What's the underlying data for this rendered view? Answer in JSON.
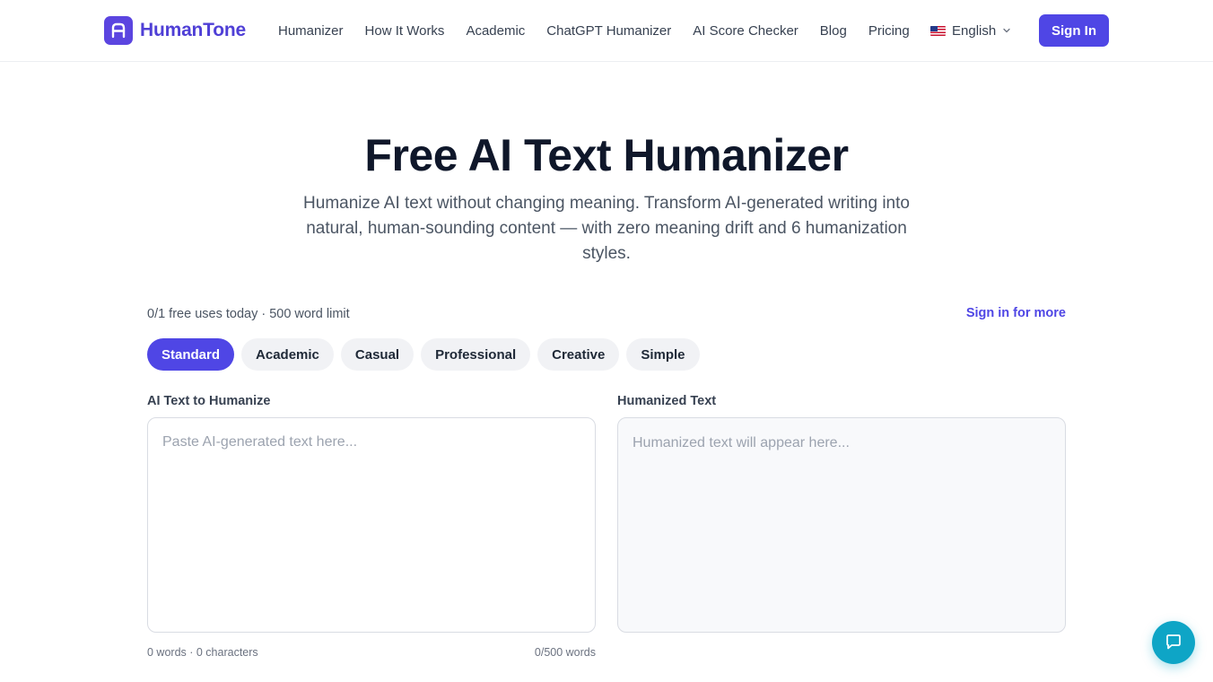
{
  "brand": {
    "name": "HumanTone",
    "color": "#4f46e5"
  },
  "nav": {
    "items": [
      {
        "label": "Humanizer"
      },
      {
        "label": "How It Works"
      },
      {
        "label": "Academic"
      },
      {
        "label": "ChatGPT Humanizer"
      },
      {
        "label": "AI Score Checker"
      },
      {
        "label": "Blog"
      },
      {
        "label": "Pricing"
      }
    ],
    "language": {
      "label": "English",
      "flag_icon": "us-flag-icon"
    },
    "sign_in_label": "Sign In"
  },
  "hero": {
    "title": "Free AI Text Humanizer",
    "subtitle": "Humanize AI text without changing meaning. Transform AI-generated writing into natural, human-sounding content — with zero meaning drift and 6 humanization styles."
  },
  "usage": {
    "status": "0/1 free uses today · 500 word limit",
    "sign_in_more": "Sign in for more"
  },
  "styles": {
    "selected": "Standard",
    "options": [
      "Standard",
      "Academic",
      "Casual",
      "Professional",
      "Creative",
      "Simple"
    ]
  },
  "input_panel": {
    "label": "AI Text to Humanize",
    "placeholder": "Paste AI-generated text here...",
    "value": "",
    "counts": "0 words · 0 characters",
    "limit": "0/500 words"
  },
  "output_panel": {
    "label": "Humanized Text",
    "placeholder": "Humanized text will appear here..."
  },
  "chat": {
    "icon": "chat-bubble-icon",
    "color": "#0ea5c6"
  }
}
